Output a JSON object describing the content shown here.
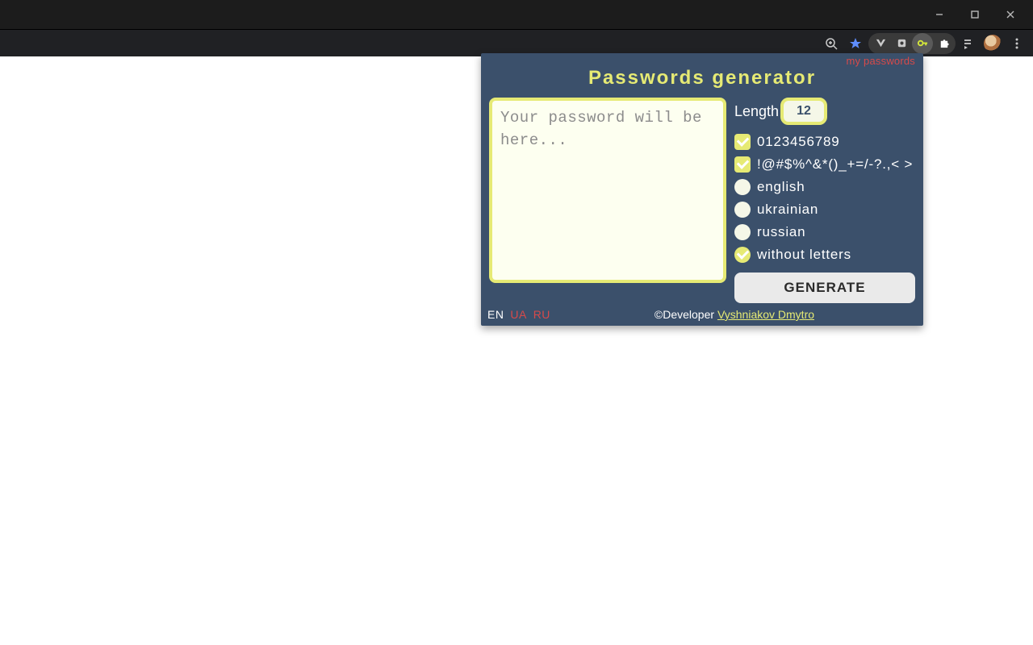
{
  "window": {
    "minimize_icon": "minimize",
    "maximize_icon": "maximize",
    "close_icon": "close"
  },
  "popup": {
    "my_passwords_link": "my passwords",
    "title": "Passwords generator",
    "password_placeholder": "Your password will be here...",
    "length_label": "Length",
    "length_value": "12",
    "options": {
      "digits": {
        "label": "0123456789",
        "checked": true
      },
      "symbols": {
        "label": "!@#$%^&*()_+=/-?.,< >",
        "checked": true
      },
      "english": {
        "label": "english",
        "selected": false
      },
      "ukrainian": {
        "label": "ukrainian",
        "selected": false
      },
      "russian": {
        "label": "russian",
        "selected": false
      },
      "without_letters": {
        "label": "without letters",
        "selected": true
      }
    },
    "generate_label": "GENERATE",
    "footer": {
      "lang_en": "EN",
      "lang_ua": "UA",
      "lang_ru": "RU",
      "dev_prefix": "©Developer ",
      "dev_name": "Vyshniakov Dmytro"
    }
  }
}
